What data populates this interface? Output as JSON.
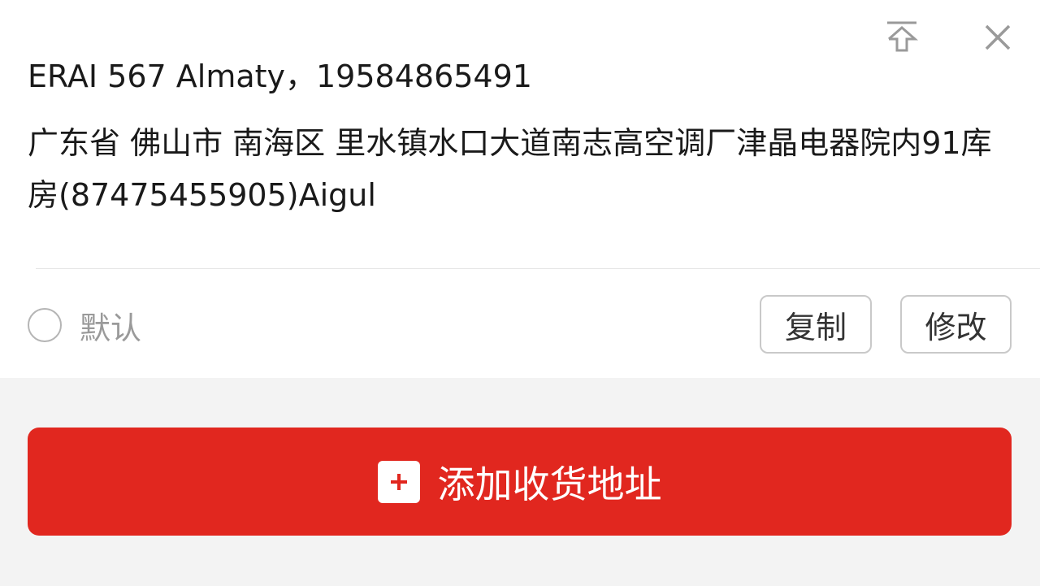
{
  "address_card": {
    "name_line": "ERAI 567 Almaty，19584865491",
    "address": "广东省 佛山市 南海区 里水镇水口大道南志高空调厂津晶电器院内91库房(87475455905)Aigul",
    "default_label": "默认",
    "copy_label": "复制",
    "edit_label": "修改",
    "icons": {
      "pin": "pin-to-top-icon",
      "close": "close-icon"
    }
  },
  "footer": {
    "add_address_label": "添加收货地址",
    "add_icon": "plus-icon"
  },
  "colors": {
    "accent_red": "#e1271f",
    "page_background": "#f3f3f3",
    "card_background": "#ffffff"
  }
}
